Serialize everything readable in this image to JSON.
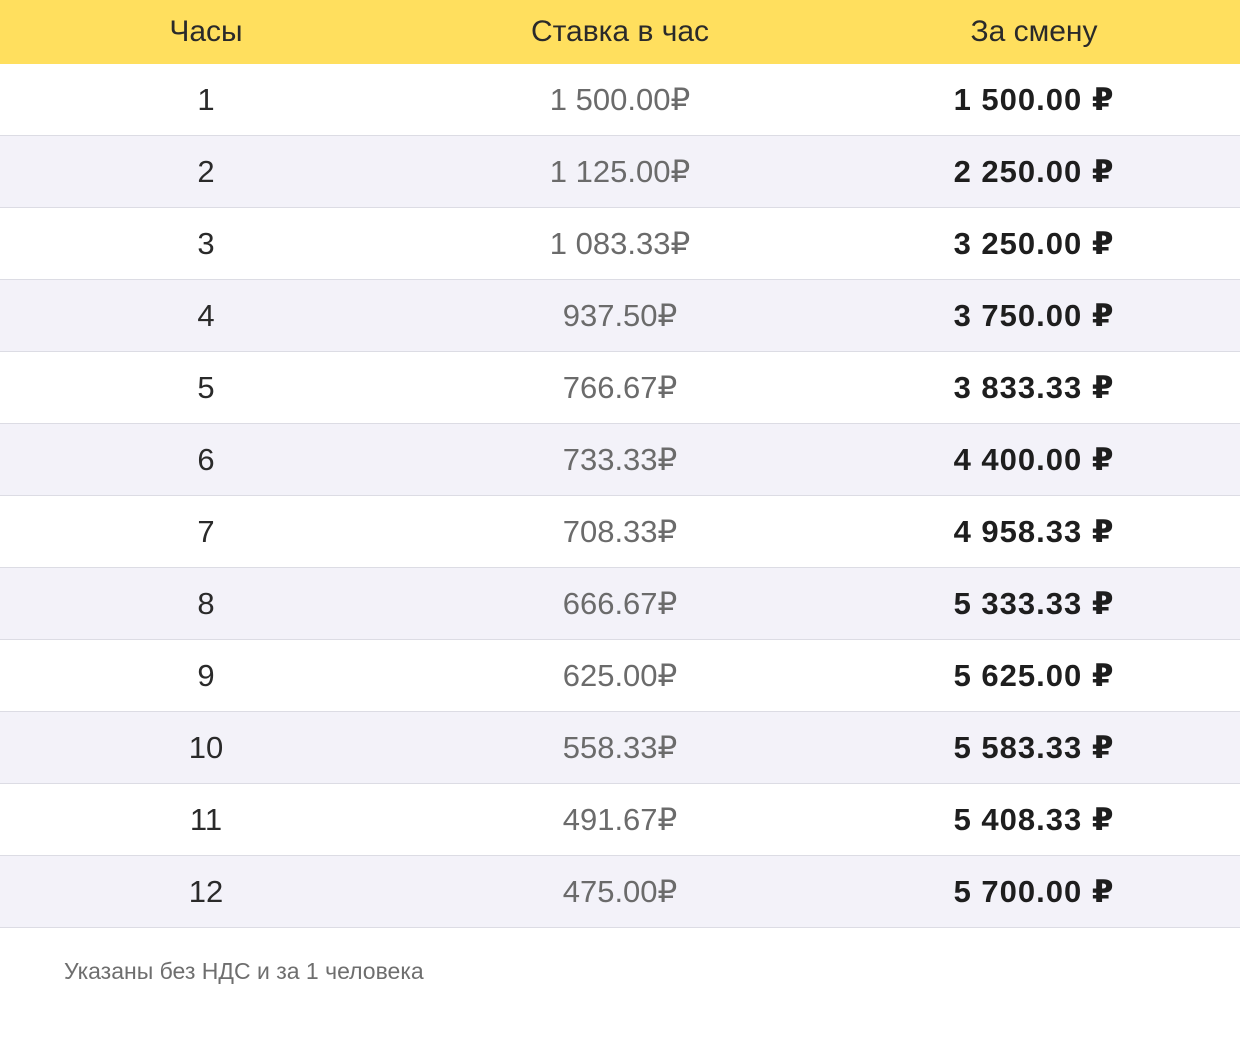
{
  "table": {
    "headers": {
      "hours": "Часы",
      "rate": "Ставка в час",
      "shift": "За смену"
    },
    "rows": [
      {
        "hours": "1",
        "rate": "1 500.00₽",
        "shift": "1 500.00 ₽"
      },
      {
        "hours": "2",
        "rate": "1 125.00₽",
        "shift": "2 250.00 ₽"
      },
      {
        "hours": "3",
        "rate": "1 083.33₽",
        "shift": "3 250.00 ₽"
      },
      {
        "hours": "4",
        "rate": "937.50₽",
        "shift": "3 750.00 ₽"
      },
      {
        "hours": "5",
        "rate": "766.67₽",
        "shift": "3 833.33 ₽"
      },
      {
        "hours": "6",
        "rate": "733.33₽",
        "shift": "4 400.00 ₽"
      },
      {
        "hours": "7",
        "rate": "708.33₽",
        "shift": "4 958.33 ₽"
      },
      {
        "hours": "8",
        "rate": "666.67₽",
        "shift": "5 333.33 ₽"
      },
      {
        "hours": "9",
        "rate": "625.00₽",
        "shift": "5 625.00 ₽"
      },
      {
        "hours": "10",
        "rate": "558.33₽",
        "shift": "5 583.33 ₽"
      },
      {
        "hours": "11",
        "rate": "491.67₽",
        "shift": "5 408.33 ₽"
      },
      {
        "hours": "12",
        "rate": "475.00₽",
        "shift": "5 700.00 ₽"
      }
    ]
  },
  "footnote": "Указаны без НДС и за 1 человека",
  "colors": {
    "header_background": "#ffdf5e",
    "stripe_background": "#f3f2f9",
    "rate_text": "#6b6b6b",
    "total_text": "#1e1e1e"
  }
}
